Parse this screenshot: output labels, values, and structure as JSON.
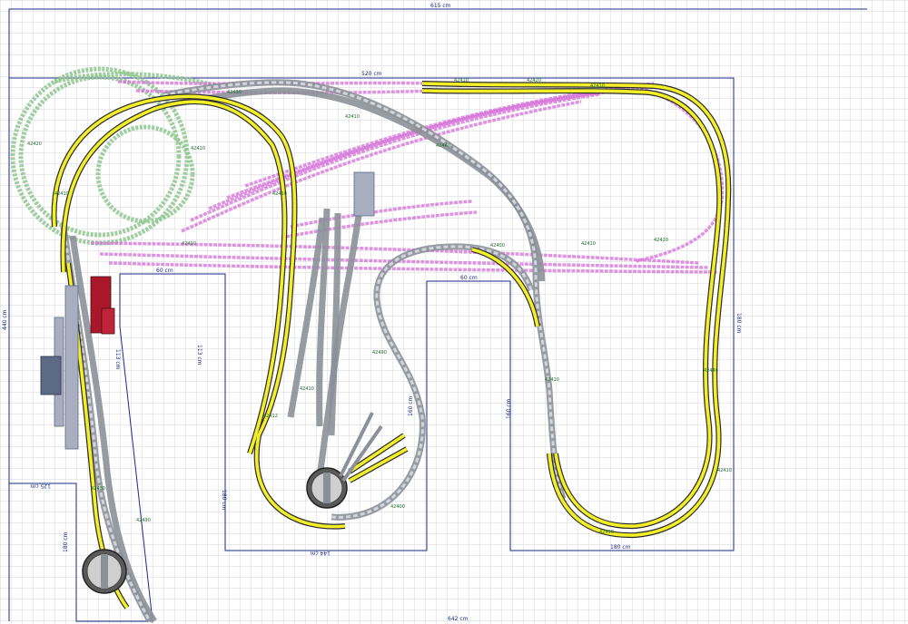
{
  "plan": {
    "dimensions": [
      {
        "id": "top-width",
        "text": "615 cm"
      },
      {
        "id": "inner-width",
        "text": "520 cm"
      },
      {
        "id": "left-height",
        "text": "440 cm"
      },
      {
        "id": "right-height",
        "text": "180 cm"
      },
      {
        "id": "bottom-width",
        "text": "642 cm"
      },
      {
        "id": "left-notch-width",
        "text": "60 cm"
      },
      {
        "id": "right-notch-width",
        "text": "60 cm"
      },
      {
        "id": "left-notch-depth",
        "text": "113 cm"
      },
      {
        "id": "left-notch-side",
        "text": "113 cm"
      },
      {
        "id": "lower-left-width",
        "text": "125 cm"
      },
      {
        "id": "lower-left-height",
        "text": "180 cm"
      },
      {
        "id": "center-pen-left",
        "text": "180 cm"
      },
      {
        "id": "center-pen-right",
        "text": "160 cm"
      },
      {
        "id": "center-pen-bottom",
        "text": "144 cm"
      },
      {
        "id": "right-pen-left",
        "text": "160 cm"
      },
      {
        "id": "right-pen-bottom",
        "text": "180 cm"
      }
    ],
    "part_number_labels": [
      "42410",
      "42420",
      "42430",
      "42440",
      "42400",
      "42490",
      "42412"
    ],
    "colors": {
      "grid": "#c8c8d2",
      "outline": "#1a2a8a",
      "level_yellow": "#f2ee2a",
      "level_grey": "#b8bcc4",
      "level_pink": "#d470d8",
      "level_green": "#8fc58f",
      "building_red": "#a8182a",
      "building_grey": "#a8aec0",
      "building_slate": "#5c6a86"
    }
  }
}
